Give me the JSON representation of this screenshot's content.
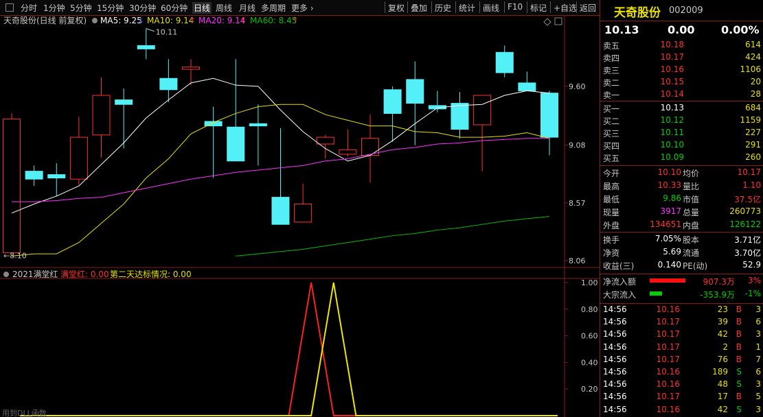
{
  "toolbar": {
    "left": [
      "分时",
      "1分钟",
      "5分钟",
      "15分钟",
      "30分钟",
      "60分钟",
      "日线",
      "周线",
      "月线",
      "多周期",
      "更多"
    ],
    "active": "日线",
    "right": [
      "复权",
      "叠加",
      "历史",
      "统计",
      "画线",
      "F10",
      "标记",
      "+自选",
      "返回"
    ]
  },
  "main_legend": {
    "title": "天奇股份(日线 前复权)",
    "ma5": "MA5: 9.25",
    "ma10": "MA10: 9.14",
    "ma20": "MA20: 9.14",
    "ma60": "MA60: 8.45",
    "arrow_ma5": "↓",
    "arrow_ma10": "↑",
    "arrow_ma20": "↑",
    "arrow_ma60": "↑",
    "high_marker": "10.11",
    "low_marker": "8.10"
  },
  "colors": {
    "ma5": "#ffffff",
    "ma10": "#e8e000",
    "ma20": "#ff30ff",
    "ma60": "#00c000",
    "up": "#ff3030",
    "down": "#54f0f8",
    "frame": "#8b1a1a"
  },
  "sub_legend": {
    "title": "2021满堂红",
    "line1": "满堂红: 0.00",
    "line2": "第二天达标情况: 0.00",
    "footer": "用到DLL函数"
  },
  "chart_data": [
    {
      "type": "candlestick",
      "title": "天奇股份(日线 前复权)",
      "y_ticks": [
        "9.60",
        "9.08",
        "8.57",
        "8.06"
      ],
      "ylim": [
        8.06,
        9.6
      ],
      "candles": [
        {
          "o": 8.13,
          "h": 9.36,
          "l": 8.13,
          "c": 9.31
        },
        {
          "o": 8.85,
          "h": 8.9,
          "l": 8.72,
          "c": 8.78
        },
        {
          "o": 8.82,
          "h": 8.92,
          "l": 8.63,
          "c": 8.79
        },
        {
          "o": 8.78,
          "h": 9.33,
          "l": 8.73,
          "c": 9.15
        },
        {
          "o": 9.17,
          "h": 9.68,
          "l": 8.97,
          "c": 9.52
        },
        {
          "o": 9.48,
          "h": 9.58,
          "l": 9.05,
          "c": 9.44
        },
        {
          "o": 9.96,
          "h": 10.11,
          "l": 9.84,
          "c": 9.93
        },
        {
          "o": 9.67,
          "h": 9.84,
          "l": 9.46,
          "c": 9.57
        },
        {
          "o": 9.75,
          "h": 9.84,
          "l": 9.61,
          "c": 9.77
        },
        {
          "o": 9.29,
          "h": 9.42,
          "l": 8.79,
          "c": 9.25
        },
        {
          "o": 9.24,
          "h": 9.84,
          "l": 8.95,
          "c": 8.94
        },
        {
          "o": 9.27,
          "h": 9.44,
          "l": 8.9,
          "c": 9.25
        },
        {
          "o": 8.62,
          "h": 9.23,
          "l": 8.39,
          "c": 8.38
        },
        {
          "o": 8.4,
          "h": 8.74,
          "l": 8.4,
          "c": 8.56
        },
        {
          "o": 9.09,
          "h": 9.17,
          "l": 8.96,
          "c": 9.15
        },
        {
          "o": 9.0,
          "h": 9.22,
          "l": 8.98,
          "c": 9.04
        },
        {
          "o": 8.99,
          "h": 9.35,
          "l": 8.75,
          "c": 9.14
        },
        {
          "o": 9.57,
          "h": 9.6,
          "l": 9.11,
          "c": 9.36
        },
        {
          "o": 9.66,
          "h": 9.82,
          "l": 9.08,
          "c": 9.45
        },
        {
          "o": 9.43,
          "h": 9.56,
          "l": 9.37,
          "c": 9.4
        },
        {
          "o": 9.45,
          "h": 9.55,
          "l": 9.14,
          "c": 9.22
        },
        {
          "o": 9.26,
          "h": 9.52,
          "l": 8.85,
          "c": 9.52
        },
        {
          "o": 9.9,
          "h": 9.96,
          "l": 9.68,
          "c": 9.72
        },
        {
          "o": 9.63,
          "h": 9.73,
          "l": 9.62,
          "c": 9.56
        },
        {
          "o": 9.54,
          "h": 9.56,
          "l": 8.99,
          "c": 9.15
        }
      ],
      "ma5": [
        8.48,
        8.56,
        8.63,
        8.72,
        8.91,
        9.1,
        9.32,
        9.48,
        9.63,
        9.67,
        9.61,
        9.6,
        9.39,
        9.2,
        9.05,
        8.94,
        8.99,
        9.12,
        9.27,
        9.41,
        9.43,
        9.44,
        9.52,
        9.56,
        9.54
      ],
      "ma10": [
        8.1,
        8.12,
        8.12,
        8.22,
        8.39,
        8.56,
        8.79,
        8.96,
        9.18,
        9.28,
        9.36,
        9.42,
        9.44,
        9.44,
        9.35,
        9.3,
        9.25,
        9.25,
        9.2,
        9.19,
        9.15,
        9.15,
        9.16,
        9.19,
        9.14
      ],
      "ma20": [
        8.58,
        8.58,
        8.59,
        8.61,
        8.62,
        8.66,
        8.7,
        8.74,
        8.78,
        8.81,
        8.84,
        8.86,
        8.88,
        8.9,
        8.94,
        8.96,
        9.0,
        9.04,
        9.06,
        9.09,
        9.1,
        9.12,
        9.13,
        9.14,
        9.14
      ],
      "ma60": [
        null,
        null,
        null,
        null,
        null,
        null,
        null,
        null,
        null,
        null,
        8.1,
        8.12,
        8.14,
        8.16,
        8.19,
        8.22,
        8.25,
        8.28,
        8.3,
        8.33,
        8.35,
        8.38,
        8.41,
        8.43,
        8.45
      ]
    },
    {
      "type": "line",
      "title": "2021满堂红",
      "y_ticks": [
        "1.00",
        "0.80",
        "0.60",
        "0.40",
        "0.20"
      ],
      "ylim": [
        0,
        1.0
      ],
      "series": [
        {
          "name": "满堂红",
          "values": [
            0,
            0,
            0,
            0,
            0,
            0,
            0,
            0,
            0,
            0,
            0,
            0,
            0,
            1,
            0,
            0,
            0,
            0,
            0,
            0,
            0,
            0,
            0,
            0,
            0
          ]
        },
        {
          "name": "第二天达标情况",
          "values": [
            0,
            0,
            0,
            0,
            0,
            0,
            0,
            0,
            0,
            0,
            0,
            0,
            0,
            0,
            1,
            0,
            0,
            0,
            0,
            0,
            0,
            0,
            0,
            0,
            0
          ]
        }
      ]
    }
  ],
  "quote": {
    "name": "天奇股份",
    "code": "002009",
    "price": "10.13",
    "change": "0.00",
    "change_pct": "0.00%",
    "asks": [
      {
        "label": "卖五",
        "price": "10.18",
        "vol": "614"
      },
      {
        "label": "卖四",
        "price": "10.17",
        "vol": "424"
      },
      {
        "label": "卖三",
        "price": "10.16",
        "vol": "1106"
      },
      {
        "label": "卖二",
        "price": "10.15",
        "vol": "20"
      },
      {
        "label": "卖一",
        "price": "10.14",
        "vol": "28"
      }
    ],
    "bids": [
      {
        "label": "买一",
        "price": "10.13",
        "vol": "684"
      },
      {
        "label": "买二",
        "price": "10.12",
        "vol": "1159"
      },
      {
        "label": "买三",
        "price": "10.11",
        "vol": "227"
      },
      {
        "label": "买四",
        "price": "10.10",
        "vol": "291"
      },
      {
        "label": "买五",
        "price": "10.09",
        "vol": "260"
      }
    ],
    "stats": [
      {
        "l1": "今开",
        "v1": "10.10",
        "l2": "均价",
        "v2": "10.17"
      },
      {
        "l1": "最高",
        "v1": "10.33",
        "l2": "量比",
        "v2": "1.10"
      },
      {
        "l1": "最低",
        "v1": "9.86",
        "l2": "市值",
        "v2": "37.5亿"
      },
      {
        "l1": "现量",
        "v1": "3917",
        "l2": "总量",
        "v2": "260773"
      },
      {
        "l1": "外盘",
        "v1": "134651",
        "l2": "内盘",
        "v2": "126122"
      }
    ],
    "stats2": [
      {
        "l1": "换手",
        "v1": "7.05%",
        "l2": "股本",
        "v2": "3.71亿"
      },
      {
        "l1": "净资",
        "v1": "5.69",
        "l2": "流通",
        "v2": "3.70亿"
      },
      {
        "l1": "收益(三)",
        "v1": "0.140",
        "l2": "PE(动)",
        "v2": "52.9"
      }
    ],
    "flows": [
      {
        "label": "净流入额",
        "value": "907.3万",
        "pct": "3%",
        "bar": 1.0
      },
      {
        "label": "大宗流入",
        "value": "-353.9万",
        "pct": "-1%",
        "bar": 0.35
      }
    ],
    "ticks": [
      {
        "t": "14:56",
        "p": "10.16",
        "v": "23",
        "s": "B",
        "n": "3"
      },
      {
        "t": "14:56",
        "p": "10.17",
        "v": "39",
        "s": "B",
        "n": "6"
      },
      {
        "t": "14:56",
        "p": "10.17",
        "v": "42",
        "s": "B",
        "n": "3"
      },
      {
        "t": "14:56",
        "p": "10.17",
        "v": "2",
        "s": "B",
        "n": "1"
      },
      {
        "t": "14:56",
        "p": "10.17",
        "v": "76",
        "s": "B",
        "n": "7"
      },
      {
        "t": "14:56",
        "p": "10.16",
        "v": "189",
        "s": "S",
        "n": "6"
      },
      {
        "t": "14:56",
        "p": "10.16",
        "v": "48",
        "s": "S",
        "n": "3"
      },
      {
        "t": "14:56",
        "p": "10.17",
        "v": "17",
        "s": "B",
        "n": "5"
      },
      {
        "t": "14:56",
        "p": "10.16",
        "v": "42",
        "s": "S",
        "n": "3"
      }
    ]
  }
}
